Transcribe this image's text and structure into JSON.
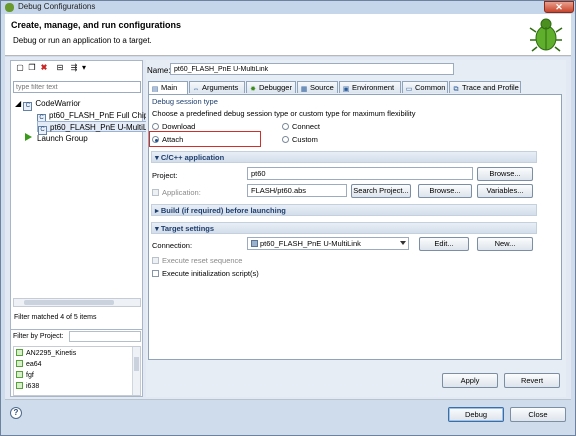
{
  "window": {
    "title": "Debug Configurations"
  },
  "header": {
    "title": "Create, manage, and run configurations",
    "subtitle": "Debug or run an application to a target."
  },
  "left_panel": {
    "filter_placeholder": "type filter text",
    "tree": [
      {
        "label": "CodeWarrior",
        "icon": "codewarrior-icon"
      },
      {
        "label": "pt60_FLASH_PnE Full Chip",
        "icon": "config-icon"
      },
      {
        "label": "pt60_FLASH_PnE U-MultiL",
        "icon": "config-icon"
      },
      {
        "label": "Launch Group",
        "icon": "launch-group-icon"
      }
    ],
    "filter_status": "Filter matched 4 of 5 items",
    "filter_by_project_label": "Filter by Project:",
    "projects": [
      "AN2295_Kinetis",
      "ea64",
      "fgf",
      "i638"
    ]
  },
  "config": {
    "name_label": "Name:",
    "name_value": "pt60_FLASH_PnE U-MultiLink",
    "tabs": [
      "Main",
      "Arguments",
      "Debugger",
      "Source",
      "Environment",
      "Common",
      "Trace and Profile"
    ],
    "session": {
      "title": "Debug session type",
      "description": "Choose a predefined debug session type or custom type for maximum flexibility",
      "options": {
        "download": "Download",
        "connect": "Connect",
        "attach": "Attach",
        "custom": "Custom"
      },
      "selected": "Attach"
    },
    "cpp": {
      "title": "C/C++ application",
      "project_label": "Project:",
      "project_value": "pt60",
      "browse": "Browse...",
      "application_label": "Application:",
      "application_value": "FLASH/pt60.abs",
      "search_project": "Search Project...",
      "browse2": "Browse...",
      "variables": "Variables..."
    },
    "build": {
      "title": "Build (if required) before launching"
    },
    "target": {
      "title": "Target settings",
      "connection_label": "Connection:",
      "connection_value": "pt60_FLASH_PnE U-MultiLink",
      "edit": "Edit...",
      "new": "New...",
      "reset": "Execute reset sequence",
      "init": "Execute initialization script(s)"
    },
    "apply": "Apply",
    "revert": "Revert"
  },
  "footer": {
    "debug": "Debug",
    "close": "Close",
    "help": "?"
  }
}
